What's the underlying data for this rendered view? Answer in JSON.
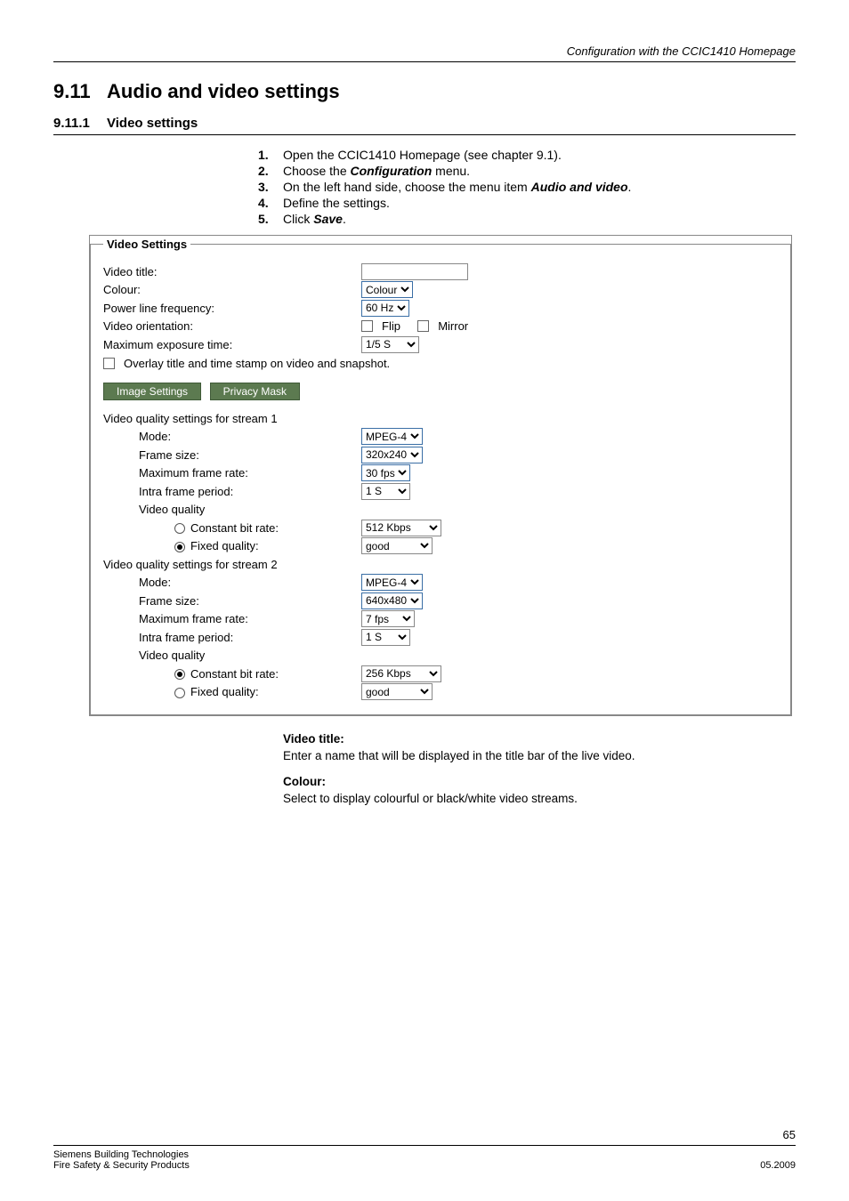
{
  "header": {
    "title": "Configuration with the CCIC1410 Homepage"
  },
  "section": {
    "num": "9.11",
    "title": "Audio and video settings",
    "sub_num": "9.11.1",
    "sub_title": "Video settings"
  },
  "steps": [
    {
      "n": "1.",
      "text_before": "Open the CCIC1410 Homepage (see chapter 9.1).",
      "em": "",
      "text_after": ""
    },
    {
      "n": "2.",
      "text_before": "Choose the ",
      "em": "Configuration",
      "text_after": " menu."
    },
    {
      "n": "3.",
      "text_before": "On the left hand side, choose the menu item ",
      "em": "Audio and video",
      "text_after": "."
    },
    {
      "n": "4.",
      "text_before": "Define the settings.",
      "em": "",
      "text_after": ""
    },
    {
      "n": "5.",
      "text_before": "Click ",
      "em": "Save",
      "text_after": "."
    }
  ],
  "vs": {
    "legend": "Video Settings",
    "video_title_label": "Video title:",
    "video_title_value": "",
    "colour_label": "Colour:",
    "colour_value": "Colour",
    "plf_label": "Power line frequency:",
    "plf_value": "60 Hz",
    "orient_label": "Video orientation:",
    "orient_flip": "Flip",
    "orient_mirror": "Mirror",
    "max_expo_label": "Maximum exposure time:",
    "max_expo_value": "1/5 S",
    "overlay_label": "Overlay title and time stamp on video and snapshot.",
    "btn_image": "Image Settings",
    "btn_privacy": "Privacy Mask",
    "s1_heading": "Video quality settings for stream 1",
    "s2_heading": "Video quality settings for stream 2",
    "mode_label": "Mode:",
    "frame_size_label": "Frame size:",
    "max_fr_label": "Maximum frame rate:",
    "intra_label": "Intra frame period:",
    "vq_label": "Video quality",
    "cbr_label": "Constant bit rate:",
    "fixq_label": "Fixed quality:",
    "s1": {
      "mode": "MPEG-4",
      "frame_size": "320x240",
      "max_fr": "30 fps",
      "intra": "1 S",
      "cbr": "512 Kbps",
      "fixq": "good"
    },
    "s2": {
      "mode": "MPEG-4",
      "frame_size": "640x480",
      "max_fr": "7 fps",
      "intra": "1 S",
      "cbr": "256 Kbps",
      "fixq": "good"
    }
  },
  "desc": {
    "vt_h": "Video title:",
    "vt_p": "Enter a name that will be displayed in the title bar of the live video.",
    "col_h": "Colour:",
    "col_p": "Select to display colourful or black/white video streams."
  },
  "footer": {
    "page": "65",
    "left1": "Siemens Building Technologies",
    "left2": "Fire Safety & Security Products",
    "right": "05.2009"
  }
}
